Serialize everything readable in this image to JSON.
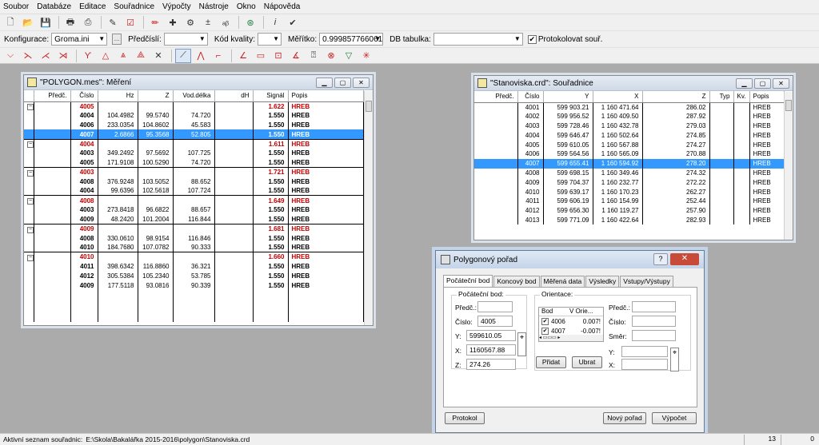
{
  "menu": [
    "Soubor",
    "Databáze",
    "Editace",
    "Souřadnice",
    "Výpočty",
    "Nástroje",
    "Okno",
    "Nápověda"
  ],
  "toolbar2": {
    "konfigurace_label": "Konfigurace:",
    "konfigurace_value": "Groma.ini",
    "predcisli_label": "Předčíslí:",
    "predcisli_value": "",
    "kod_label": "Kód kvality:",
    "kod_value": "",
    "meritko_label": "Měřítko:",
    "meritko_value": "0.999857766061",
    "db_label": "DB tabulka:",
    "db_value": "",
    "protokol_label": "Protokolovat souř.",
    "protokol_checked": true
  },
  "mereni": {
    "title": "\"POLYGON.mes\": Měření",
    "columns": [
      "Předč.",
      "Číslo",
      "Hz",
      "Z",
      "Vod.délka",
      "dH",
      "Signál",
      "Popis"
    ],
    "rows": [
      {
        "group": true,
        "cislo": "4005",
        "hz": "",
        "z": "",
        "vd": "",
        "dh": "",
        "signal": "1.622",
        "popis": "HREB"
      },
      {
        "group": false,
        "cislo": "4004",
        "hz": "104.4982",
        "z": "99.5740",
        "vd": "74.720",
        "dh": "",
        "signal": "1.550",
        "popis": "HREB"
      },
      {
        "group": false,
        "cislo": "4006",
        "hz": "233.0354",
        "z": "104.8602",
        "vd": "45.583",
        "dh": "",
        "signal": "1.550",
        "popis": "HREB"
      },
      {
        "group": false,
        "selected": true,
        "cislo": "4007",
        "hz": "2.6866",
        "z": "95.3568",
        "vd": "52.805",
        "dh": "",
        "signal": "1.550",
        "popis": "HREB"
      },
      {
        "group": true,
        "cislo": "4004",
        "hz": "",
        "z": "",
        "vd": "",
        "dh": "",
        "signal": "1.611",
        "popis": "HREB"
      },
      {
        "group": false,
        "cislo": "4003",
        "hz": "349.2492",
        "z": "97.5692",
        "vd": "107.725",
        "dh": "",
        "signal": "1.550",
        "popis": "HREB"
      },
      {
        "group": false,
        "cislo": "4005",
        "hz": "171.9108",
        "z": "100.5290",
        "vd": "74.720",
        "dh": "",
        "signal": "1.550",
        "popis": "HREB"
      },
      {
        "group": true,
        "cislo": "4003",
        "hz": "",
        "z": "",
        "vd": "",
        "dh": "",
        "signal": "1.721",
        "popis": "HREB"
      },
      {
        "group": false,
        "cislo": "4008",
        "hz": "376.9248",
        "z": "103.5052",
        "vd": "88.652",
        "dh": "",
        "signal": "1.550",
        "popis": "HREB"
      },
      {
        "group": false,
        "cislo": "4004",
        "hz": "99.6396",
        "z": "102.5618",
        "vd": "107.724",
        "dh": "",
        "signal": "1.550",
        "popis": "HREB"
      },
      {
        "group": true,
        "cislo": "4008",
        "hz": "",
        "z": "",
        "vd": "",
        "dh": "",
        "signal": "1.649",
        "popis": "HREB"
      },
      {
        "group": false,
        "cislo": "4003",
        "hz": "273.8418",
        "z": "96.6822",
        "vd": "88.657",
        "dh": "",
        "signal": "1.550",
        "popis": "HREB"
      },
      {
        "group": false,
        "cislo": "4009",
        "hz": "48.2420",
        "z": "101.2004",
        "vd": "116.844",
        "dh": "",
        "signal": "1.550",
        "popis": "HREB"
      },
      {
        "group": true,
        "cislo": "4009",
        "hz": "",
        "z": "",
        "vd": "",
        "dh": "",
        "signal": "1.681",
        "popis": "HREB"
      },
      {
        "group": false,
        "cislo": "4008",
        "hz": "330.0610",
        "z": "98.9154",
        "vd": "116.846",
        "dh": "",
        "signal": "1.550",
        "popis": "HREB"
      },
      {
        "group": false,
        "cislo": "4010",
        "hz": "184.7680",
        "z": "107.0782",
        "vd": "90.333",
        "dh": "",
        "signal": "1.550",
        "popis": "HREB"
      },
      {
        "group": true,
        "cislo": "4010",
        "hz": "",
        "z": "",
        "vd": "",
        "dh": "",
        "signal": "1.660",
        "popis": "HREB"
      },
      {
        "group": false,
        "cislo": "4011",
        "hz": "398.6342",
        "z": "116.8860",
        "vd": "36.321",
        "dh": "",
        "signal": "1.550",
        "popis": "HREB"
      },
      {
        "group": false,
        "cislo": "4012",
        "hz": "305.5384",
        "z": "105.2340",
        "vd": "53.785",
        "dh": "",
        "signal": "1.550",
        "popis": "HREB"
      },
      {
        "group": false,
        "cislo": "4009",
        "hz": "177.5118",
        "z": "93.0816",
        "vd": "90.339",
        "dh": "",
        "signal": "1.550",
        "popis": "HREB"
      }
    ]
  },
  "souradnice": {
    "title": "\"Stanoviska.crd\": Souřadnice",
    "columns": [
      "Předč.",
      "Číslo",
      "Y",
      "X",
      "Z",
      "Typ",
      "Kv.",
      "Popis"
    ],
    "rows": [
      {
        "cislo": "4001",
        "y": "599 903.21",
        "x": "1 160 471.64",
        "z": "286.02",
        "popis": "HREB"
      },
      {
        "cislo": "4002",
        "y": "599 956.52",
        "x": "1 160 409.50",
        "z": "287.92",
        "popis": "HREB"
      },
      {
        "cislo": "4003",
        "y": "599 728.46",
        "x": "1 160 432.78",
        "z": "279.03",
        "popis": "HREB"
      },
      {
        "cislo": "4004",
        "y": "599 646.47",
        "x": "1 160 502.64",
        "z": "274.85",
        "popis": "HREB"
      },
      {
        "cislo": "4005",
        "y": "599 610.05",
        "x": "1 160 567.88",
        "z": "274.27",
        "popis": "HREB"
      },
      {
        "cislo": "4006",
        "y": "599 564.56",
        "x": "1 160 565.09",
        "z": "270.88",
        "popis": "HREB"
      },
      {
        "cislo": "4007",
        "y": "599 655.41",
        "x": "1 160 594.92",
        "z": "278.20",
        "popis": "HREB",
        "selected": true
      },
      {
        "cislo": "4008",
        "y": "599 698.15",
        "x": "1 160 349.46",
        "z": "274.32",
        "popis": "HREB"
      },
      {
        "cislo": "4009",
        "y": "599 704.37",
        "x": "1 160 232.77",
        "z": "272.22",
        "popis": "HREB"
      },
      {
        "cislo": "4010",
        "y": "599 639.17",
        "x": "1 160 170.23",
        "z": "262.27",
        "popis": "HREB"
      },
      {
        "cislo": "4011",
        "y": "599 606.19",
        "x": "1 160 154.99",
        "z": "252.44",
        "popis": "HREB"
      },
      {
        "cislo": "4012",
        "y": "599 656.30",
        "x": "1 160 119.27",
        "z": "257.90",
        "popis": "HREB"
      },
      {
        "cislo": "4013",
        "y": "599 771.09",
        "x": "1 160 422.64",
        "z": "282.93",
        "popis": "HREB"
      }
    ]
  },
  "dialog": {
    "title": "Polygonový pořad",
    "help": "?",
    "tabs": [
      "Počáteční bod",
      "Koncový bod",
      "Měřená data",
      "Výsledky",
      "Vstupy/Výstupy"
    ],
    "pocatecni_group": "Počáteční bod:",
    "orientace_group": "Orientace:",
    "predc_label": "Předč.:",
    "predc_value": "",
    "cislo_label": "Číslo:",
    "cislo_value": "4005",
    "y_label": "Y:",
    "y_value": "599610.05",
    "x_label": "X:",
    "x_value": "1160567.88",
    "z_label": "Z:",
    "z_value": "274.26",
    "orient_col_bod": "Bod",
    "orient_col_v": "V Orie...",
    "orient_rows": [
      {
        "bod": "4006",
        "v": "0.007!"
      },
      {
        "bod": "4007",
        "v": "-0.007!"
      }
    ],
    "pridat": "Přidat",
    "ubrat": "Ubrat",
    "r_predc_label": "Předč.:",
    "r_cislo_label": "Číslo:",
    "r_smer_label": "Směr:",
    "r_y_label": "Y:",
    "r_x_label": "X:",
    "protokol": "Protokol",
    "novy": "Nový pořad",
    "vypocet": "Výpočet"
  },
  "status": {
    "label": "Aktivní seznam souřadnic:",
    "path": "E:\\Skola\\Bakalářka 2015-2016\\polygon\\Stanoviska.crd",
    "count": "13",
    "zero": "0"
  }
}
